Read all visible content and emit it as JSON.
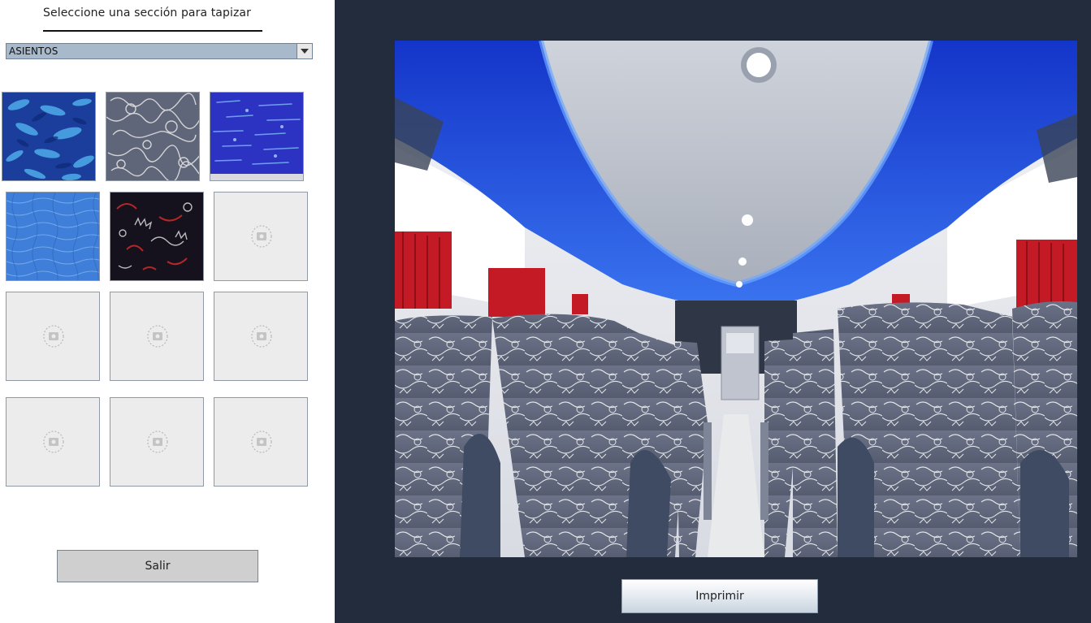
{
  "header": {
    "title": "Seleccione una sección para tapizar"
  },
  "section_select": {
    "selected": "ASIENTOS"
  },
  "fabrics": [
    {
      "name": "blue-fish-pattern",
      "colors": [
        "#1d3f9e",
        "#4aa6e6"
      ]
    },
    {
      "name": "white-scribble-pattern",
      "colors": [
        "#5e6579",
        "#dcdcdc"
      ]
    },
    {
      "name": "royal-blue-streaks",
      "colors": [
        "#2b34c4",
        "#6fb2f0"
      ]
    },
    {
      "name": "light-blue-texture",
      "colors": [
        "#3d7cd8",
        "#7fb2ee"
      ]
    },
    {
      "name": "dark-red-swirl",
      "colors": [
        "#16131f",
        "#c72a2a"
      ]
    }
  ],
  "placeholder_icon": "image-placeholder-icon",
  "buttons": {
    "exit_label": "Salir",
    "print_label": "Imprimir"
  },
  "colors": {
    "panel_dark": "#232c3d",
    "select_bg": "#a8b9cc",
    "ceiling_blue": "#1e3fcf",
    "curtain_red": "#c31a25"
  }
}
